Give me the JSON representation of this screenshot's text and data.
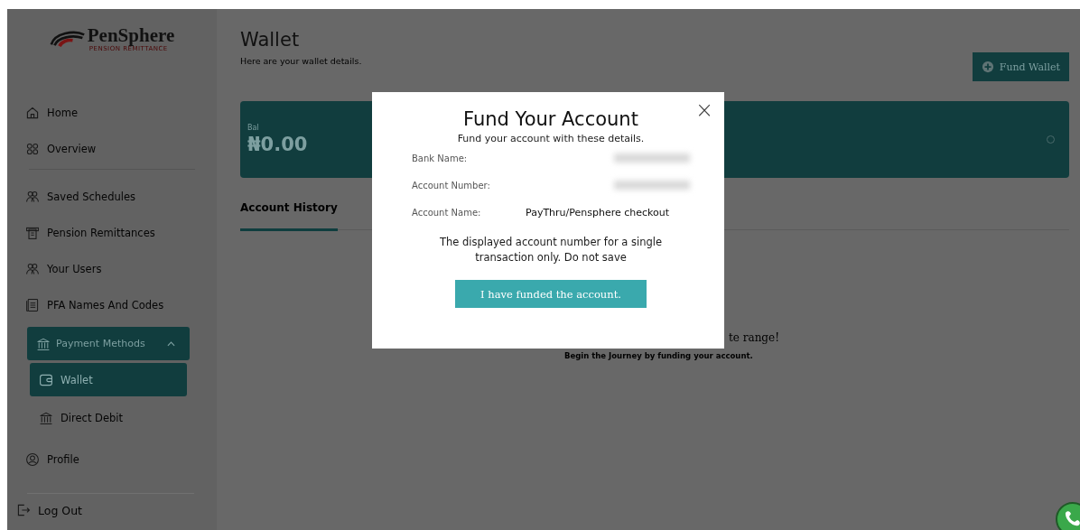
{
  "brand": {
    "name": "PenSphere",
    "tagline": "PENSION REMITTANCE"
  },
  "sidebar": {
    "items": [
      {
        "kind": "link",
        "label": "Home",
        "selected": false
      },
      {
        "kind": "link",
        "label": "Overview",
        "selected": false
      },
      {
        "kind": "divider"
      },
      {
        "kind": "link",
        "label": "Saved Schedules",
        "selected": false
      },
      {
        "kind": "link",
        "label": "Pension Remittances",
        "selected": false
      },
      {
        "kind": "link",
        "label": "Your Users",
        "selected": false
      },
      {
        "kind": "link",
        "label": "PFA Names And Codes",
        "selected": false
      },
      {
        "kind": "group",
        "label": "Payment Methods",
        "expanded": true,
        "children": [
          {
            "label": "Wallet",
            "selected": true
          },
          {
            "label": "Direct Debit",
            "selected": false
          }
        ]
      },
      {
        "kind": "link",
        "label": "Profile",
        "selected": false
      }
    ],
    "logout": "Log Out"
  },
  "header": {
    "title": "Wallet",
    "subtitle": "Here are your wallet details.",
    "action": "Fund Wallet"
  },
  "balance": {
    "label": "Bal",
    "amount": "₦0.00"
  },
  "tabs": [
    {
      "label": "Account History",
      "selected": true
    }
  ],
  "empty_state": {
    "title": "te range!",
    "message": "Begin the Journey by funding your account."
  },
  "modal": {
    "close": "×",
    "title": "Fund Your Account",
    "subtitle": "Fund your account with these details.",
    "fields": [
      {
        "label": "Bank Name:",
        "redacted": true
      },
      {
        "label": "Account Number:",
        "redacted": true
      },
      {
        "label": "Account Name:",
        "redacted": false,
        "value": "PayThru/Pensphere checkout"
      }
    ],
    "note": "The displayed account number for a single transaction only. Do not save",
    "button": "I have funded the account."
  }
}
